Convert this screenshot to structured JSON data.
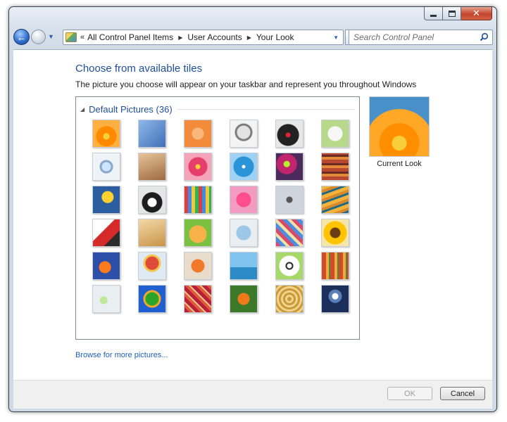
{
  "window": {
    "address": {
      "crumbs": [
        "All Control Panel Items",
        "User Accounts",
        "Your Look"
      ]
    },
    "search": {
      "placeholder": "Search Control Panel"
    }
  },
  "main": {
    "title": "Choose from available tiles",
    "description": "The picture you choose will appear on your taskbar and represent you throughout Windows",
    "group": {
      "title": "Default Pictures (36)"
    },
    "tiles": [
      {
        "name": "orange-daisy",
        "bg": "radial-gradient(circle at 50% 60%, #f5d23a 0 4px, #ff8a00 5px 14px, #ffb040 15px)"
      },
      {
        "name": "white-ferris-wheel",
        "bg": "linear-gradient(135deg, #8fb8e8, #3f6fb8)"
      },
      {
        "name": "starfish",
        "bg": "radial-gradient(circle, #f9b87a 0 8px, #f28b3c 9px)"
      },
      {
        "name": "robot-figure",
        "bg": "radial-gradient(circle at 50% 45%, #e3e3e3 0 9px, #7b7b7b 10px 12px, #f3f3f3 13px)"
      },
      {
        "name": "record-player",
        "bg": "radial-gradient(circle at 45% 55%, #d23 0 3px, #222 4px 15px, #e7e7e7 16px)"
      },
      {
        "name": "lucky-cat",
        "bg": "radial-gradient(circle at 50% 50%, #f7f7f7 0 10px, #b8d88a 11px)"
      },
      {
        "name": "gyroscope",
        "bg": "radial-gradient(circle, #cfe4ff 0 6px, #8aa6c8 7px 9px, #eef3f8 10px)"
      },
      {
        "name": "kitten",
        "bg": "linear-gradient(160deg, #e8c49a, #9c6b3e)"
      },
      {
        "name": "pink-flower",
        "bg": "radial-gradient(circle, #ffd03a 0 3px, #e63e6a 4px 13px, #f4a3b8 14px)"
      },
      {
        "name": "pinwheel",
        "bg": "radial-gradient(circle, #ffffff 0 2px, #2b93d8 3px 14px, #9ed1f3 15px)"
      },
      {
        "name": "green-ball",
        "bg": "radial-gradient(circle at 40% 40%, #b6f02c 0 4px, #c0246d 5px 14px, #4b2b5c 15px)"
      },
      {
        "name": "fabric-stack",
        "bg": "repeating-linear-gradient(0deg, #b8472f 0 5px, #e38a3a 5px 9px, #6a2c22 9px 12px)"
      },
      {
        "name": "yellow-leaf",
        "bg": "radial-gradient(circle at 55% 40%, #ffd030 0 8px, #2c5d9f 9px)"
      },
      {
        "name": "dog",
        "bg": "radial-gradient(circle at 50% 60%, #ffffff 0 6px, #1d1d1d 7px 14px, #e6e6e6 15px)"
      },
      {
        "name": "crayons",
        "bg": "repeating-linear-gradient(90deg, #e23b3b 0 5px, #3b8ce2 5px 10px, #f0c83a 10px 15px, #2fb35a 15px 20px)"
      },
      {
        "name": "pink-star",
        "bg": "radial-gradient(circle, #ff4d8d 0 10px, #f19cc0 11px)"
      },
      {
        "name": "jacks",
        "bg": "radial-gradient(circle, #555 0 4px, #cfd5dc 5px)"
      },
      {
        "name": "yellow-stairs",
        "bg": "repeating-linear-gradient(160deg, #f3b23a 0 5px, #d9892a 5px 9px, #1f6b85 9px 12px)"
      },
      {
        "name": "origami-crane",
        "bg": "linear-gradient(135deg, #ffffff 40%, #d42a2a 41% 70%, #2b2b2b 71%)"
      },
      {
        "name": "guitar",
        "bg": "linear-gradient(160deg, #f2d8a8, #c99448)"
      },
      {
        "name": "pomeranian",
        "bg": "radial-gradient(circle at 50% 55%, #f7b24a 0 12px, #7ac142 13px)"
      },
      {
        "name": "robot-toy",
        "bg": "radial-gradient(circle, #9cc7e6 0 10px, #e9eef3 11px)"
      },
      {
        "name": "umbrellas",
        "bg": "repeating-linear-gradient(45deg, #d84a6a 0 5px, #4c8de0 5px 10px, #f3e2a8 10px 14px)"
      },
      {
        "name": "sunflower",
        "bg": "radial-gradient(circle, #6a3d12 0 7px, #ffc400 8px 16px, #f6e6a8 17px)"
      },
      {
        "name": "goldfish",
        "bg": "radial-gradient(circle at 45% 55%, #ff7a1a 0 8px, #2d4fa8 9px)"
      },
      {
        "name": "hot-air-balloon",
        "bg": "radial-gradient(circle at 50% 40%, #e04a3a 0 9px, #f2c94c 10px 12px, #dfeaf5 13px)"
      },
      {
        "name": "fish-ornament",
        "bg": "radial-gradient(circle, #f07a2a 0 9px, #e8dccd 10px)"
      },
      {
        "name": "sailboat",
        "bg": "linear-gradient(180deg, #7fc4ef 0 55%, #2c8bc6 56%)"
      },
      {
        "name": "soccer-ball",
        "bg": "radial-gradient(circle, #ffffff 0 3px, #222 4px 5px, #ffffff 6px 14px, #a7d96a 15px)"
      },
      {
        "name": "fabric-red",
        "bg": "repeating-linear-gradient(90deg, #d24a2a 0 6px, #f2a83a 6px 10px, #4a8a3a 10px 12px)"
      },
      {
        "name": "marbles",
        "bg": "radial-gradient(circle at 40% 55%, #c1e89a 0 5px, #e9eef3 6px)"
      },
      {
        "name": "green-window",
        "bg": "radial-gradient(circle, #2aa52a 0 9px, #f2a82a 10px 12px, #1f5fd0 13px)"
      },
      {
        "name": "woven-pattern",
        "bg": "repeating-linear-gradient(45deg, #b8203a 0 5px, #e05a3a 5px 9px, #f2c08a 9px 11px)"
      },
      {
        "name": "butterfly",
        "bg": "radial-gradient(circle, #f07a1a 0 8px, #3c7a2a 9px)"
      },
      {
        "name": "spiral-basket",
        "bg": "repeating-radial-gradient(circle, #c89a3a 0 3px, #f2d38a 3px 6px)"
      },
      {
        "name": "lighthouse",
        "bg": "radial-gradient(circle at 50% 40%, #ffffff 0 4px, #5a7fb8 5px 9px, #1b2f5a 10px)"
      }
    ],
    "browse_link": "Browse for more pictures...",
    "current": {
      "label": "Current Look"
    }
  },
  "footer": {
    "ok_label": "OK",
    "cancel_label": "Cancel"
  },
  "colors": {
    "link": "#1e5fb7",
    "heading": "#1e4e9a"
  }
}
